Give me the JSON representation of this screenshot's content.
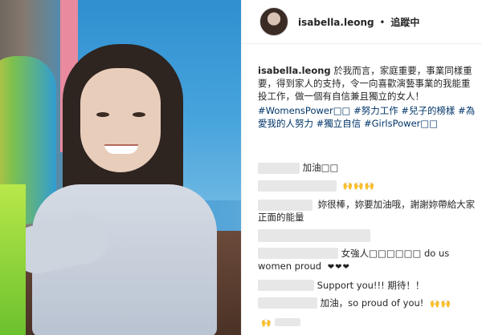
{
  "header": {
    "username": "isabella.leong",
    "separator": "•",
    "follow_status": "追蹤中"
  },
  "caption": {
    "username": "isabella.leong",
    "text": "於我而言，家庭重要，事業同樣重要，得到家人的支持，令一向喜歡演藝事業的我能重投工作，做一個有自信兼且獨立的女人！",
    "hashtags": "#WomensPower□□ #努力工作 #兒子的榜樣 #為愛我的人努力 #獨立自信 #GirlsPower□□"
  },
  "comments": [
    {
      "text": "加油□□",
      "emoji": ""
    },
    {
      "text": "",
      "emoji": "🙌🙌🙌"
    },
    {
      "text": "妳很棒，妳要加油哦，謝謝妳帶給大家正面的能量",
      "emoji": ""
    },
    {
      "text": "",
      "emoji": ""
    },
    {
      "text": "女強人□□□□□□ do us women proud",
      "emoji": "❤❤❤"
    },
    {
      "text": "Support you!!! 期待！！",
      "emoji": ""
    },
    {
      "text": "加油，so proud of you!",
      "emoji": "🙌🙌"
    },
    {
      "text": "",
      "emoji": "🙌"
    }
  ]
}
